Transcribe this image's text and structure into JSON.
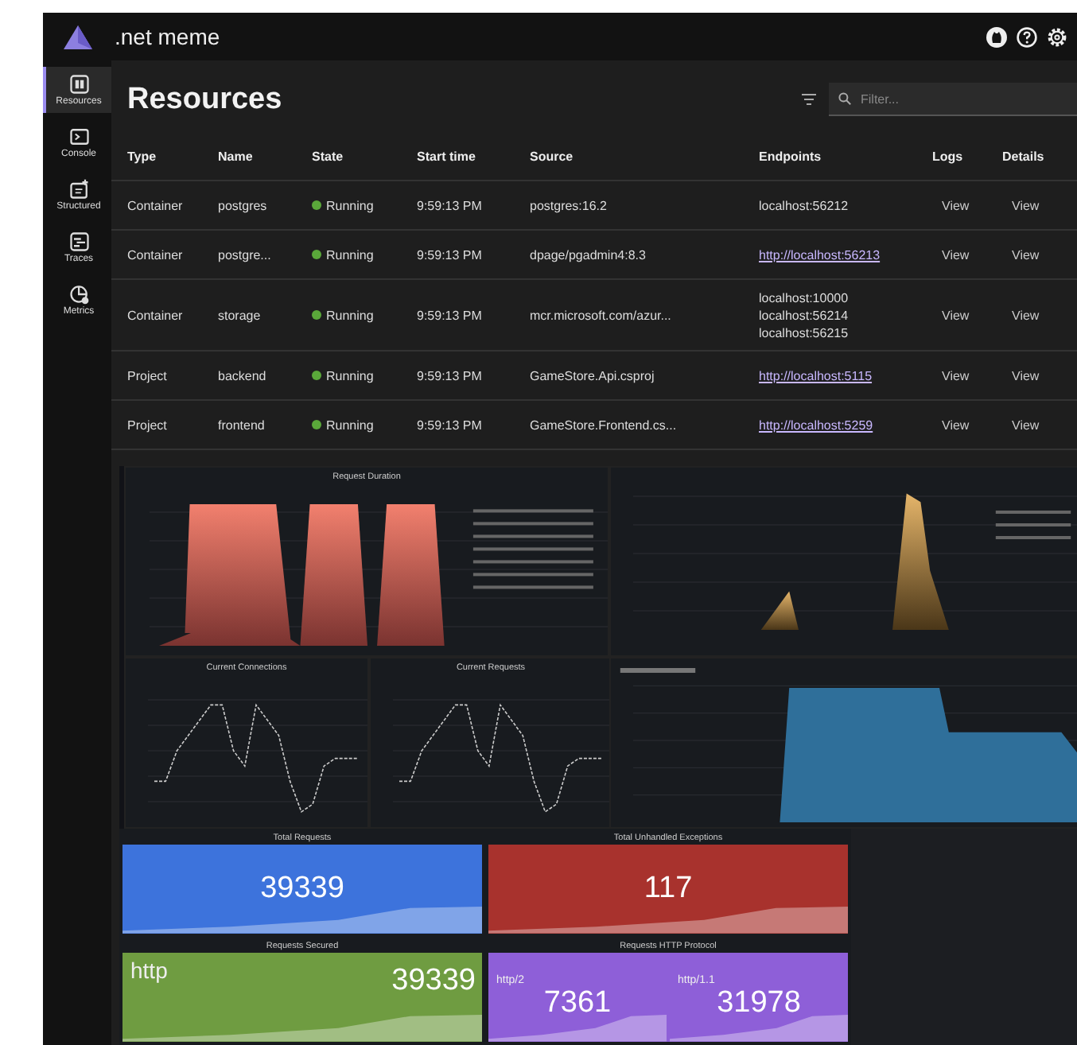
{
  "app": {
    "title": ".net meme"
  },
  "sidebar": {
    "items": [
      {
        "label": "Resources",
        "selected": true
      },
      {
        "label": "Console",
        "selected": false
      },
      {
        "label": "Structured",
        "selected": false
      },
      {
        "label": "Traces",
        "selected": false
      },
      {
        "label": "Metrics",
        "selected": false
      }
    ]
  },
  "page": {
    "title": "Resources",
    "filter": {
      "placeholder": "Filter..."
    }
  },
  "table": {
    "columns": [
      "Type",
      "Name",
      "State",
      "Start time",
      "Source",
      "Endpoints",
      "Logs",
      "Details"
    ],
    "rows": [
      {
        "type": "Container",
        "name": "postgres",
        "state": "Running",
        "start_time": "9:59:13 PM",
        "source": "postgres:16.2",
        "endpoints": [
          {
            "text": "localhost:56212",
            "link": false
          }
        ],
        "logs": "View",
        "details": "View"
      },
      {
        "type": "Container",
        "name": "postgre...",
        "state": "Running",
        "start_time": "9:59:13 PM",
        "source": "dpage/pgadmin4:8.3",
        "endpoints": [
          {
            "text": "http://localhost:56213",
            "link": true
          }
        ],
        "logs": "View",
        "details": "View"
      },
      {
        "type": "Container",
        "name": "storage",
        "state": "Running",
        "start_time": "9:59:13 PM",
        "source": "mcr.microsoft.com/azur...",
        "endpoints": [
          {
            "text": "localhost:10000",
            "link": false
          },
          {
            "text": "localhost:56214",
            "link": false
          },
          {
            "text": "localhost:56215",
            "link": false
          }
        ],
        "logs": "View",
        "details": "View"
      },
      {
        "type": "Project",
        "name": "backend",
        "state": "Running",
        "start_time": "9:59:13 PM",
        "source": "GameStore.Api.csproj",
        "endpoints": [
          {
            "text": "http://localhost:5115",
            "link": true
          }
        ],
        "logs": "View",
        "details": "View"
      },
      {
        "type": "Project",
        "name": "frontend",
        "state": "Running",
        "start_time": "9:59:13 PM",
        "source": "GameStore.Frontend.cs...",
        "endpoints": [
          {
            "text": "http://localhost:5259",
            "link": true
          }
        ],
        "logs": "View",
        "details": "View"
      }
    ]
  },
  "dashboard": {
    "charts": [
      {
        "kind": "area",
        "title": "Request Duration"
      },
      {
        "kind": "spike"
      },
      {
        "kind": "line",
        "title": "Current Connections"
      },
      {
        "kind": "line",
        "title": "Current Requests"
      },
      {
        "kind": "step"
      }
    ],
    "stats": [
      {
        "title": "Total Requests",
        "color": "#3d73dc",
        "values": [
          {
            "value": "39339"
          }
        ]
      },
      {
        "title": "Total Unhandled Exceptions",
        "color": "#a8322d",
        "values": [
          {
            "value": "117"
          }
        ]
      },
      {
        "title": "Requests Secured",
        "color": "#6f9c41",
        "values": [
          {
            "label": "http",
            "value": "39339"
          }
        ]
      },
      {
        "title": "Requests HTTP Protocol",
        "color": "#8e5fd8",
        "values": [
          {
            "label": "http/2",
            "value": "7361"
          },
          {
            "label": "http/1.1",
            "value": "31978"
          }
        ]
      }
    ]
  }
}
